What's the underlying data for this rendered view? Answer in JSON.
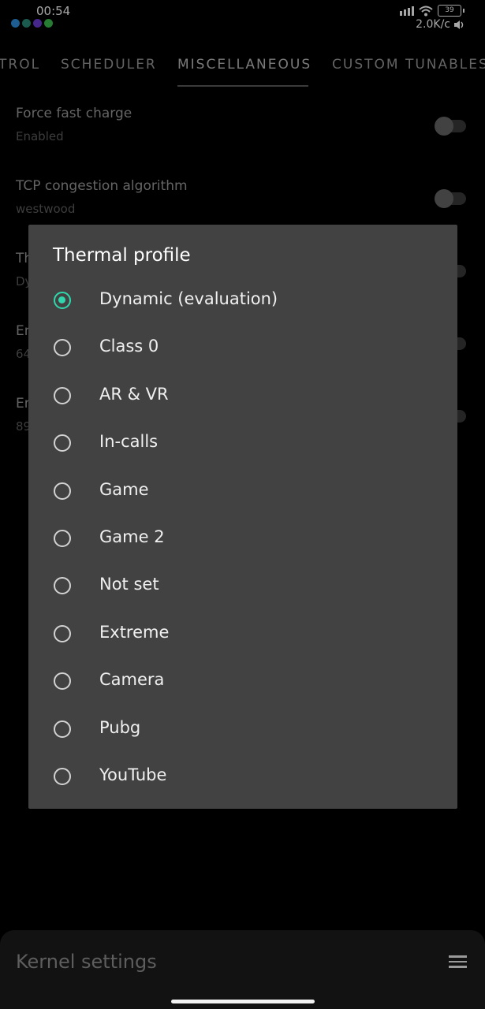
{
  "status_bar": {
    "time": "00:54",
    "battery_level": "39",
    "network_speed": "2.0K/c",
    "icons": [
      "notification-app-icon",
      "notification-app-icon",
      "notification-app-icon",
      "notification-app-icon",
      "signal-icon",
      "wifi-icon",
      "battery-icon",
      "volume-icon"
    ]
  },
  "tabs": [
    {
      "label": "TROL",
      "active": false
    },
    {
      "label": "SCHEDULER",
      "active": false
    },
    {
      "label": "MISCELLANEOUS",
      "active": true
    },
    {
      "label": "CUSTOM TUNABLES",
      "active": false
    }
  ],
  "settings": [
    {
      "title": "Force fast charge",
      "subtitle": "Enabled"
    },
    {
      "title": "TCP congestion algorithm",
      "subtitle": "westwood"
    },
    {
      "title": "Th",
      "subtitle": "Dy"
    },
    {
      "title": "En",
      "subtitle": "64"
    },
    {
      "title": "En",
      "subtitle": "89"
    }
  ],
  "dialog": {
    "title": "Thermal profile",
    "selected_index": 0,
    "options": [
      "Dynamic (evaluation)",
      "Class 0",
      "AR & VR",
      "In-calls",
      "Game",
      "Game 2",
      "Not set",
      "Extreme",
      "Camera",
      "Pubg",
      "YouTube"
    ]
  },
  "bottom_bar": {
    "title": "Kernel settings",
    "menu_icon": "hamburger-menu-icon"
  },
  "colors": {
    "accent": "#31d7ac",
    "dialog_background": "#424242",
    "background": "#000000"
  }
}
